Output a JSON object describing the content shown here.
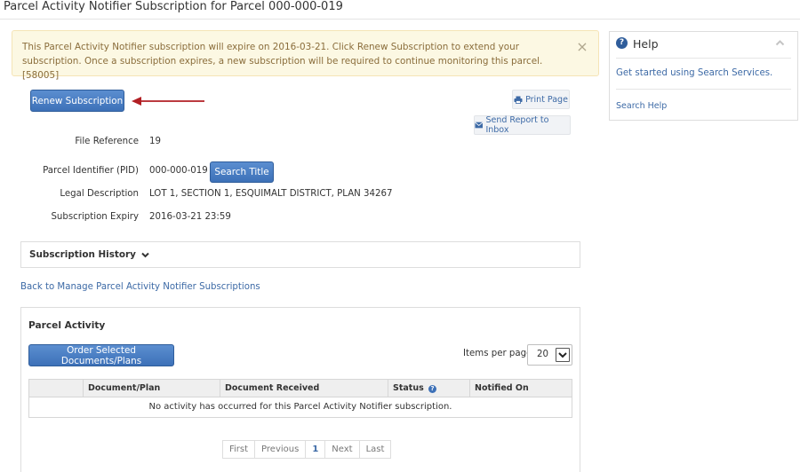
{
  "page": {
    "title": "Parcel Activity Notifier Subscription for Parcel 000-000-019"
  },
  "alert": {
    "message": "This Parcel Activity Notifier subscription will expire on 2016-03-21. Click Renew Subscription to extend your subscription. Once a subscription expires, a new subscription will be required to continue monitoring this parcel. [58005]",
    "close_glyph": "×",
    "colors": {
      "background": "#fcf8e3",
      "text": "#8a6d3b"
    }
  },
  "actions": {
    "renew_label": "Renew Subscription",
    "print_label": "Print Page",
    "send_report_label": "Send Report to Inbox",
    "search_title_label": "Search Title"
  },
  "fields": {
    "file_reference": {
      "label": "File Reference",
      "value": "19"
    },
    "pid": {
      "label": "Parcel Identifier (PID)",
      "value": "000-000-019"
    },
    "legal_description": {
      "label": "Legal Description",
      "value": "LOT 1, SECTION 1, ESQUIMALT DISTRICT, PLAN 34267"
    },
    "subscription_expiry": {
      "label": "Subscription Expiry",
      "value": "2016-03-21 23:59"
    }
  },
  "history": {
    "label": "Subscription History"
  },
  "back_link": "Back to Manage Parcel Activity Notifier Subscriptions",
  "activity": {
    "title": "Parcel Activity",
    "order_label": "Order Selected Documents/Plans",
    "items_per_page_label": "Items per page",
    "items_per_page_value": "20",
    "columns": [
      "",
      "Document/Plan",
      "Document Received",
      "Status",
      "Notified On"
    ],
    "empty_message": "No activity has occurred for this Parcel Activity Notifier subscription.",
    "pagination": {
      "first": "First",
      "previous": "Previous",
      "current": "1",
      "next": "Next",
      "last": "Last"
    }
  },
  "help": {
    "title": "Help",
    "icon_glyph": "?",
    "link_get_started": "Get started using Search Services.",
    "link_search_help": "Search Help"
  },
  "colors": {
    "primary_button": "#3d71b8",
    "link": "#3d6aa6",
    "annotation_arrow": "#b21f24"
  },
  "icons": {
    "close": "close-icon",
    "print": "printer-icon",
    "send": "envelope-icon",
    "expand": "chevron-down-icon",
    "collapse": "chevron-up-icon",
    "help": "question-circle-icon",
    "status_info": "info-icon",
    "annotation": "arrow-left-icon"
  }
}
